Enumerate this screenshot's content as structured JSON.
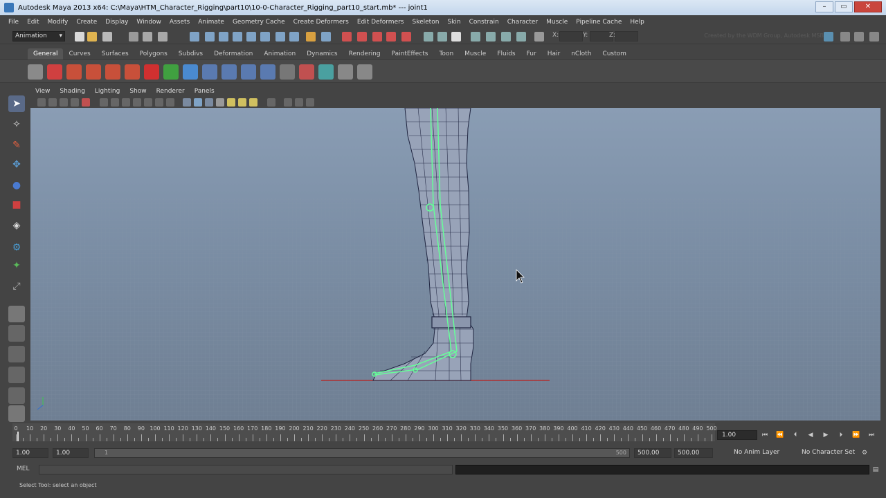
{
  "window": {
    "title": "Autodesk Maya 2013 x64: C:\\Maya\\HTM_Character_Rigging\\part10\\10-0-Character_Rigging_part10_start.mb*   ---   joint1",
    "minimize": "–",
    "maximize": "▭",
    "close": "✕"
  },
  "menubar": [
    "File",
    "Edit",
    "Modify",
    "Create",
    "Display",
    "Window",
    "Assets",
    "Animate",
    "Geometry Cache",
    "Create Deformers",
    "Edit Deformers",
    "Skeleton",
    "Skin",
    "Constrain",
    "Character",
    "Muscle",
    "Pipeline Cache",
    "Help"
  ],
  "statusline": {
    "mode": "Animation",
    "credit": "Created by the WDM Group, Autodesk MSB",
    "x_label": "X:",
    "y_label": "Y:",
    "z_label": "Z:"
  },
  "shelf_tabs": [
    "General",
    "Curves",
    "Surfaces",
    "Polygons",
    "Subdivs",
    "Deformation",
    "Animation",
    "Dynamics",
    "Rendering",
    "PaintEffects",
    "Toon",
    "Muscle",
    "Fluids",
    "Fur",
    "Hair",
    "nCloth",
    "Custom"
  ],
  "active_shelf_tab": "General",
  "panel_menu": [
    "View",
    "Shading",
    "Lighting",
    "Show",
    "Renderer",
    "Panels"
  ],
  "timeslider": {
    "ticks": [
      0,
      10,
      20,
      30,
      40,
      50,
      60,
      70,
      80,
      90,
      100,
      110,
      120,
      130,
      140,
      150,
      160,
      170,
      180,
      190,
      200,
      210,
      220,
      230,
      240,
      250,
      260,
      270,
      280,
      290,
      300,
      310,
      320,
      330,
      340,
      350,
      360,
      370,
      380,
      390,
      400,
      410,
      420,
      430,
      440,
      450,
      460,
      470,
      480,
      490,
      500
    ],
    "current_frame": "1.00"
  },
  "rangeslider": {
    "anim_start": "1.00",
    "range_start": "1.00",
    "bar_start": "1",
    "bar_end": "500",
    "range_end": "500.00",
    "anim_end": "500.00",
    "anim_layer": "No Anim Layer",
    "character_set": "No Character Set"
  },
  "cmdline": {
    "label": "MEL"
  },
  "helpline": {
    "text": "Select Tool: select an object"
  },
  "colors": {
    "viewport_top": "#8a9db4",
    "viewport_bottom": "#6f7f93",
    "joint_color": "#66ff99",
    "mesh_wire": "#1f2540"
  }
}
